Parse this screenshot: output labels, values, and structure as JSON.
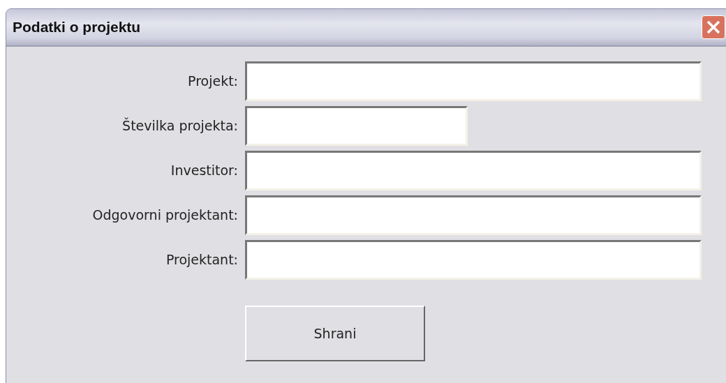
{
  "window": {
    "title": "Podatki o projektu"
  },
  "fields": [
    {
      "label": "Projekt:",
      "kind": "long"
    },
    {
      "label": "Številka projekta:",
      "kind": "short"
    },
    {
      "label": "Investitor:",
      "kind": "long"
    },
    {
      "label": "Odgovorni projektant:",
      "kind": "long"
    },
    {
      "label": "Projektant:",
      "kind": "long"
    }
  ],
  "buttons": [
    "Shrani"
  ]
}
